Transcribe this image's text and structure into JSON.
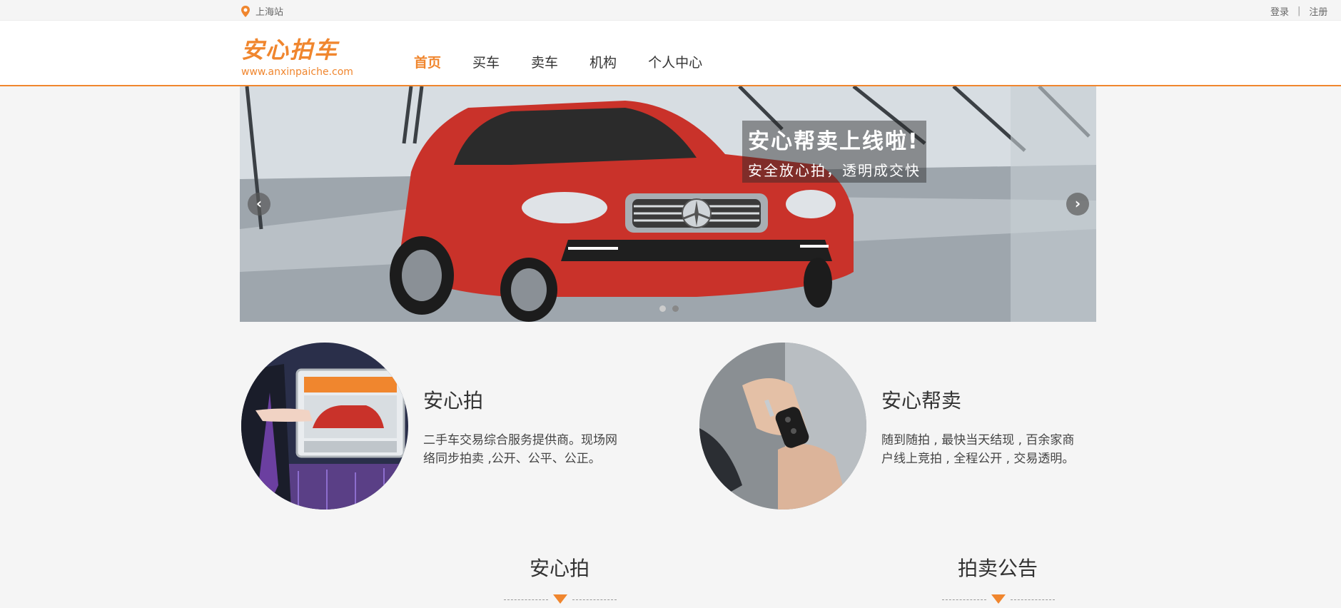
{
  "topbar": {
    "location": "上海站",
    "login": "登录",
    "separator": "|",
    "register": "注册"
  },
  "header": {
    "logo_name": "安心拍车",
    "logo_url": "www.anxinpaiche.com"
  },
  "nav": {
    "items": [
      "首页",
      "买车",
      "卖车",
      "机构",
      "个人中心"
    ],
    "active_index": 0
  },
  "banner": {
    "title": "安心帮卖上线啦!",
    "subtitle": "安全放心拍，透明成交快",
    "slide_count": 2,
    "active_slide": 0
  },
  "features": [
    {
      "title": "安心拍",
      "desc": "二手车交易综合服务提供商。现场网络同步拍卖 ,公开、公平、公正。"
    },
    {
      "title": "安心帮卖",
      "desc": "随到随拍 , 最快当天结现 , 百余家商户线上竞拍 , 全程公开 , 交易透明。"
    }
  ],
  "sections": [
    "安心拍",
    "拍卖公告"
  ],
  "colors": {
    "accent": "#f0862e",
    "background": "#f5f5f5",
    "text": "#333333"
  },
  "icons": {
    "location": "location-pin-icon",
    "prev": "chevron-left-icon",
    "next": "chevron-right-icon",
    "divider": "triangle-down-icon"
  }
}
